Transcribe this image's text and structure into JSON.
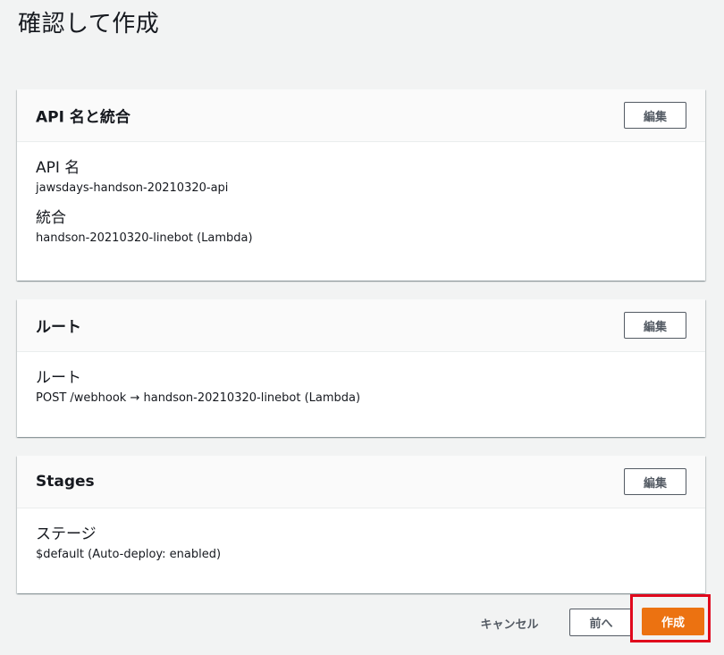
{
  "page": {
    "title": "確認して作成"
  },
  "panels": [
    {
      "title": "API 名と統合",
      "edit_label": "編集",
      "fields": [
        {
          "label": "API 名",
          "value": "jawsdays-handson-20210320-api"
        },
        {
          "label": "統合",
          "value": "handson-20210320-linebot (Lambda)"
        }
      ]
    },
    {
      "title": "ルート",
      "edit_label": "編集",
      "fields": [
        {
          "label": "ルート",
          "value": "POST /webhook → handson-20210320-linebot (Lambda)"
        }
      ]
    },
    {
      "title": "Stages",
      "edit_label": "編集",
      "fields": [
        {
          "label": "ステージ",
          "value": "$default (Auto-deploy: enabled)"
        }
      ]
    }
  ],
  "footer": {
    "cancel_label": "キャンセル",
    "previous_label": "前へ",
    "create_label": "作成"
  },
  "colors": {
    "primary_button": "#ec7211",
    "highlight": "#e0091d",
    "background": "#f2f3f3"
  }
}
